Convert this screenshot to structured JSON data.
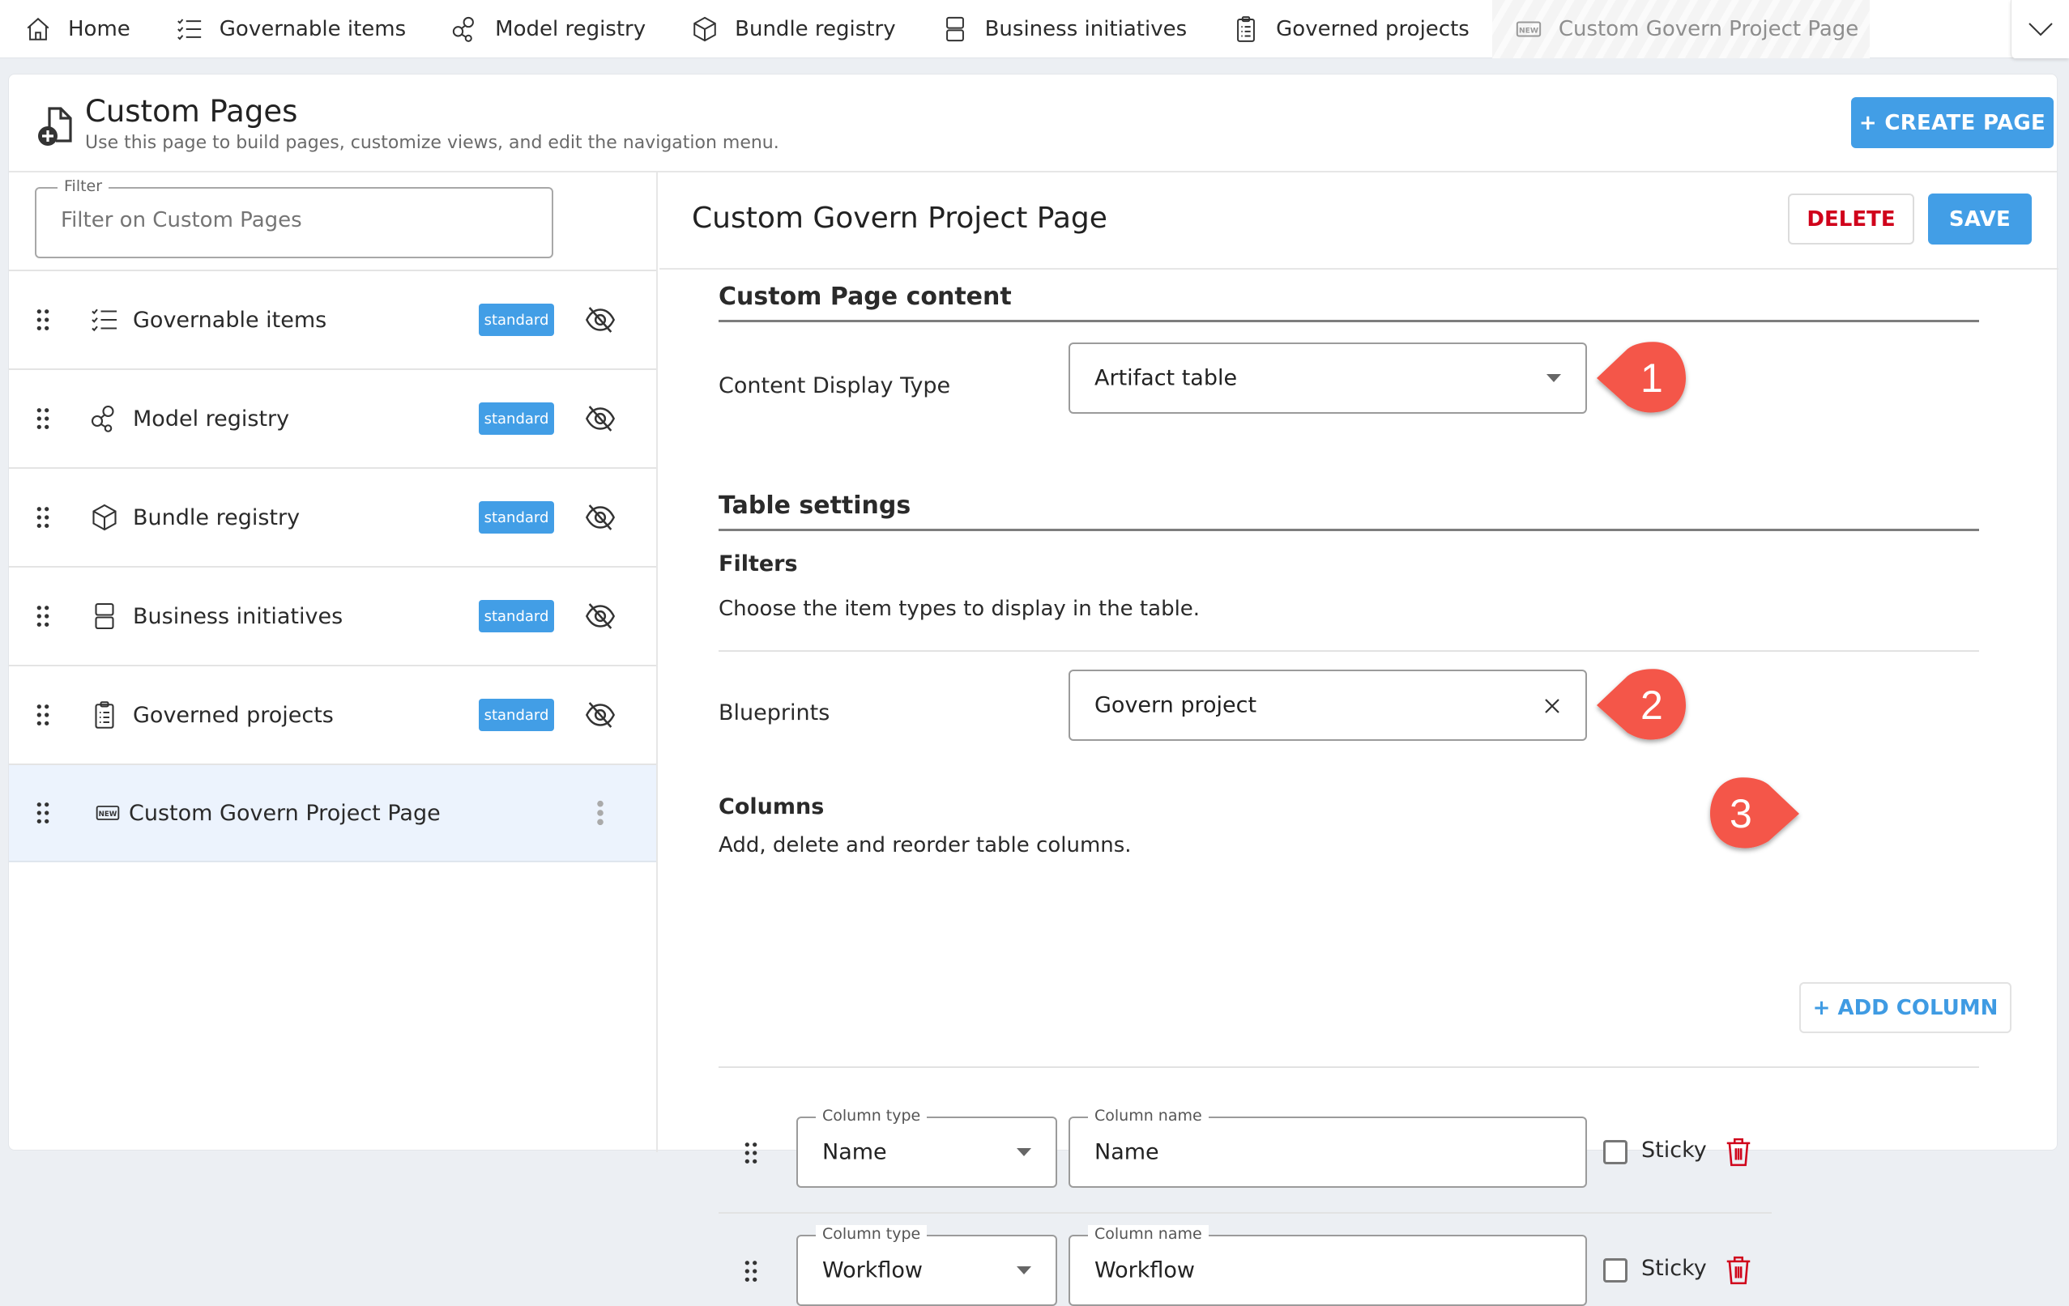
{
  "topnav": {
    "items": [
      {
        "label": "Home",
        "icon": "home-icon"
      },
      {
        "label": "Governable items",
        "icon": "checklist-icon"
      },
      {
        "label": "Model registry",
        "icon": "nodes-icon"
      },
      {
        "label": "Bundle registry",
        "icon": "cube-icon"
      },
      {
        "label": "Business initiatives",
        "icon": "stacked-boxes-icon"
      },
      {
        "label": "Governed projects",
        "icon": "clipboard-icon"
      },
      {
        "label": "Custom Govern Project Page",
        "icon": "new-badge-icon",
        "current": true
      }
    ],
    "more_icon": "chevron-down-icon"
  },
  "header": {
    "title": "Custom Pages",
    "subtitle": "Use this page to build pages, customize views, and edit the navigation menu.",
    "create_button": "+ CREATE PAGE"
  },
  "sidebar": {
    "filter": {
      "label": "Filter",
      "placeholder": "Filter on Custom Pages",
      "value": ""
    },
    "items": [
      {
        "label": "Governable items",
        "badge": "standard",
        "icon": "checklist-icon",
        "hidden_icon": "eye-off-icon"
      },
      {
        "label": "Model registry",
        "badge": "standard",
        "icon": "nodes-icon",
        "hidden_icon": "eye-off-icon"
      },
      {
        "label": "Bundle registry",
        "badge": "standard",
        "icon": "cube-icon",
        "hidden_icon": "eye-off-icon"
      },
      {
        "label": "Business initiatives",
        "badge": "standard",
        "icon": "stacked-boxes-icon",
        "hidden_icon": "eye-off-icon"
      },
      {
        "label": "Governed projects",
        "badge": "standard",
        "icon": "clipboard-icon",
        "hidden_icon": "eye-off-icon"
      },
      {
        "label": "Custom Govern Project Page",
        "icon": "new-badge-icon",
        "selected": true,
        "menu_icon": "kebab-icon"
      }
    ]
  },
  "panel": {
    "title": "Custom Govern Project Page",
    "delete_button": "DELETE",
    "save_button": "SAVE",
    "content_section": {
      "title": "Custom Page content",
      "display_type_label": "Content Display Type",
      "display_type_value": "Artifact table"
    },
    "table_settings": {
      "title": "Table settings",
      "filters_title": "Filters",
      "filters_desc": "Choose the item types to display in the table.",
      "blueprints_label": "Blueprints",
      "blueprints_value": "Govern project",
      "columns_title": "Columns",
      "columns_desc": "Add, delete and reorder table columns.",
      "add_column_button": "+ ADD COLUMN",
      "column_type_label": "Column type",
      "column_name_label": "Column name",
      "sticky_label": "Sticky",
      "columns": [
        {
          "type": "Name",
          "name": "Name",
          "sticky": false
        },
        {
          "type": "Workflow",
          "name": "Workflow",
          "sticky": false
        }
      ]
    },
    "callouts": [
      "1",
      "2",
      "3"
    ]
  },
  "colors": {
    "primary": "#429ee6",
    "danger": "#d0021b",
    "callout": "#f4574a",
    "selected_row": "#ecf3fd"
  }
}
